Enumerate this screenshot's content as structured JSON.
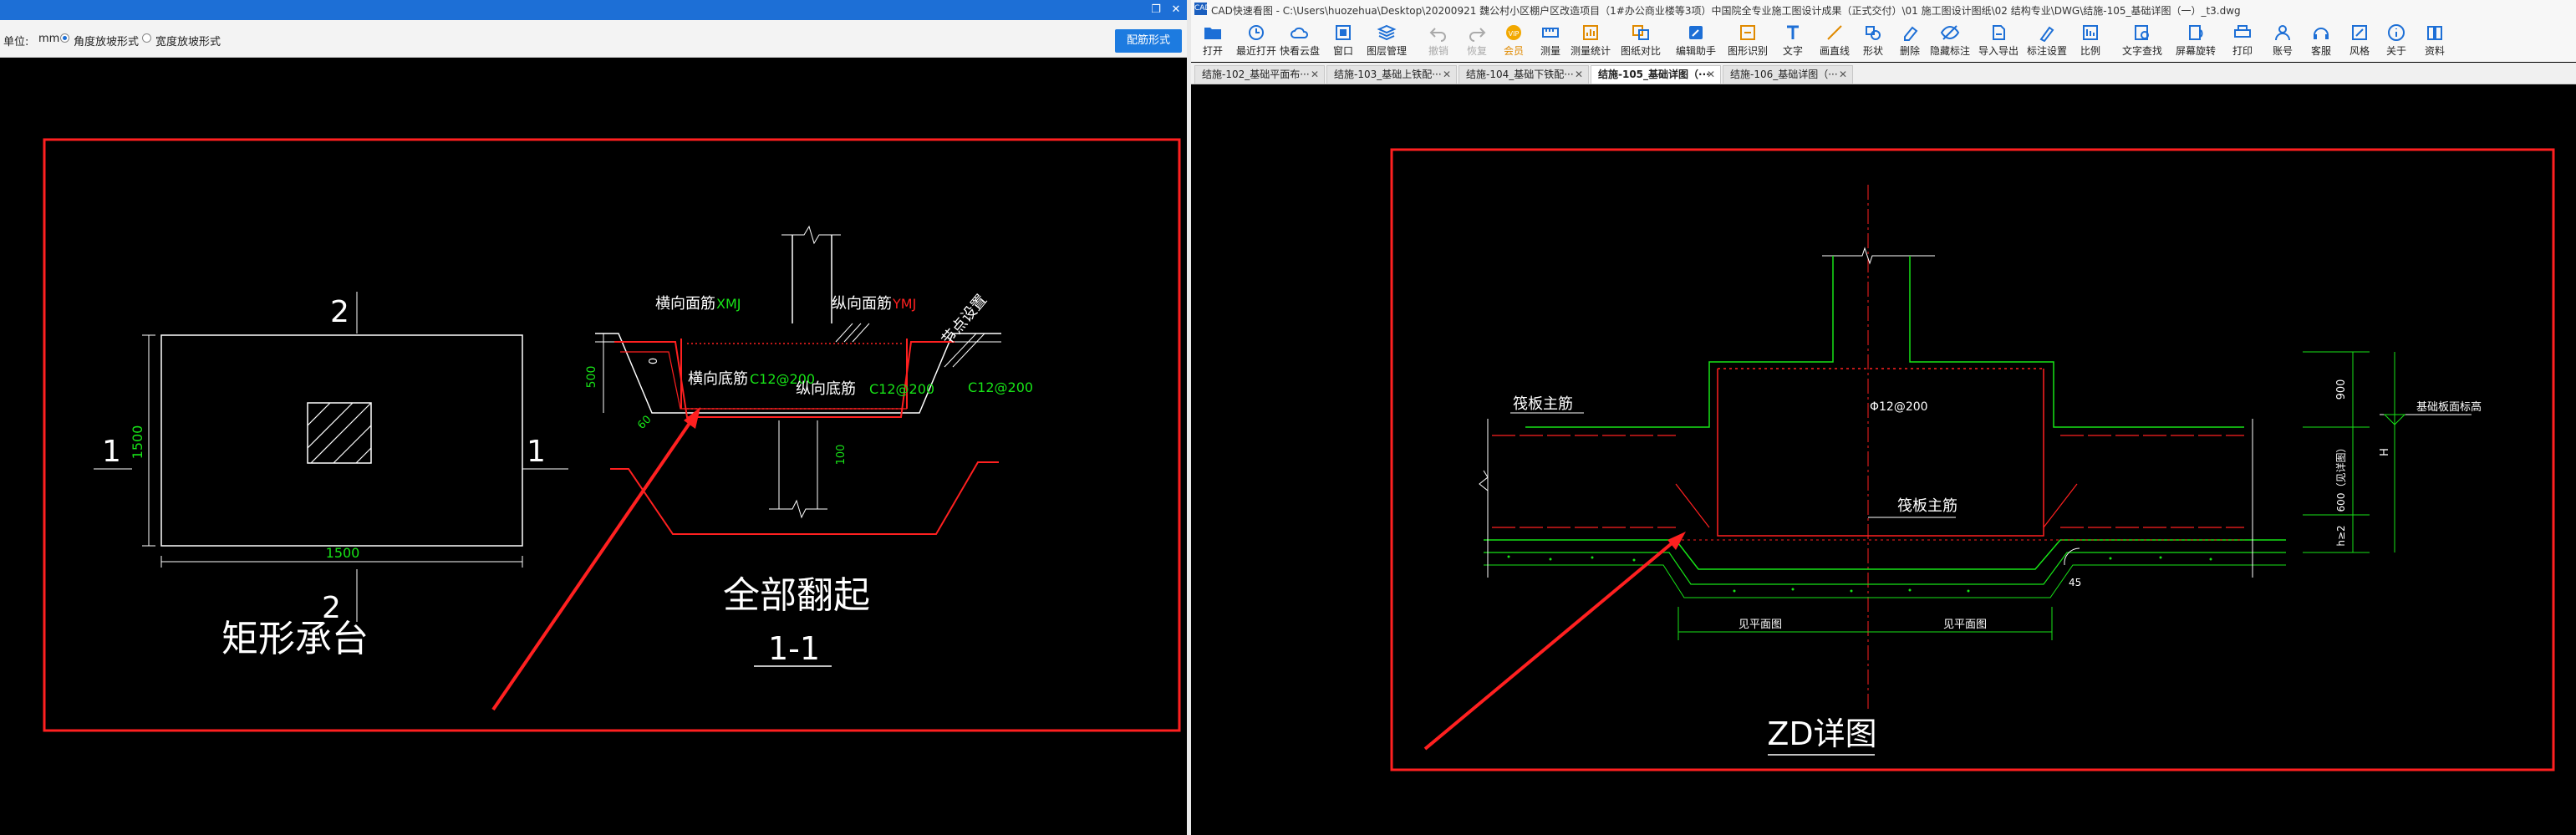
{
  "left": {
    "unit_label": "单位:",
    "unit_value": "mm",
    "option_a": "角度放坡形式",
    "option_b": "宽度放坡形式",
    "apply_button": "配筋形式",
    "drawing": {
      "dim_side": "1500",
      "dim_bottom": "1500",
      "sec_mark_top": "2",
      "sec_mark_bottom": "2",
      "sec_mark_left": "1",
      "sec_mark_right": "1",
      "plan_title": "矩形承台",
      "section_title": "全部翻起",
      "section_name": "1-1",
      "lbl_h_top": "横向面筋",
      "lbl_h_top_code": "XMJ",
      "lbl_v_top": "纵向面筋",
      "lbl_v_top_code": "YMJ",
      "lbl_anchor": "节点设置",
      "lbl_h_bot": "横向底筋",
      "lbl_h_bot_val": "C12@200",
      "lbl_v_bot": "纵向底筋",
      "lbl_v_bot_val": "C12@200",
      "lbl_right_val": "C12@200",
      "dim_height": "500",
      "dim_cover": "0",
      "dim_angle": "60",
      "dim_100": "100"
    }
  },
  "right": {
    "app_title": "CAD快速看图 - C:\\Users\\huozehua\\Desktop\\20200921 魏公村小区棚户区改造项目（1#办公商业楼等3项）中国院全专业施工图设计成果（正式交付）\\01 施工图设计图纸\\02 结构专业\\DWG\\结施-105_基础详图（一）_t3.dwg",
    "ribbon": [
      "打开",
      "最近打开",
      "快看云盘",
      "窗口",
      "图层管理",
      "撤销",
      "恢复",
      "会员",
      "测量",
      "测量统计",
      "图纸对比",
      "编辑助手",
      "图形识别",
      "文字",
      "画直线",
      "形状",
      "删除",
      "隐藏标注",
      "导入导出",
      "标注设置",
      "比例",
      "文字查找",
      "屏幕旋转",
      "打印",
      "账号",
      "客服",
      "风格",
      "关于",
      "资料"
    ],
    "tabs": [
      "结施-102_基础平面布···",
      "结施-103_基础上铁配···",
      "结施-104_基础下铁配···",
      "结施-105_基础详图（···",
      "结施-106_基础详图（···"
    ],
    "active_tab": 3,
    "drawing": {
      "lbl_raft_top": "筏板主筋",
      "lbl_phi": "Φ12@200",
      "lbl_raft_mid": "筏板主筋",
      "lbl_see_plan_1": "见平面图",
      "lbl_see_plan_2": "见平面图",
      "lbl_900": "900",
      "lbl_600": "600（见详图）",
      "lbl_h": "H",
      "lbl_h2": "h≥2",
      "lbl_elev": "基础板面标高",
      "lbl_slope": "45",
      "title": "ZD详图"
    }
  },
  "colors": {
    "cad_red": "#ff2020",
    "cad_green": "#17e317",
    "cad_white": "#ffffff",
    "accent_blue": "#1d7be0"
  }
}
